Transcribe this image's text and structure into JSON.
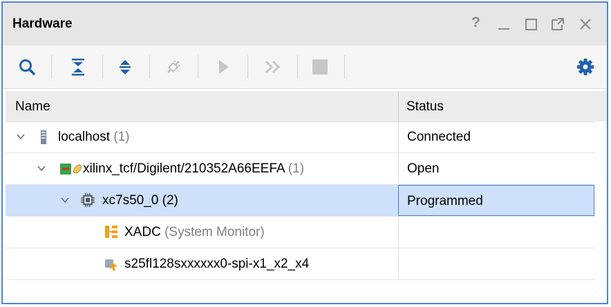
{
  "window": {
    "title": "Hardware",
    "controls": {
      "help": "?",
      "minimize_icon": "minimize-icon",
      "maximize_icon": "maximize-icon",
      "float_icon": "float-icon",
      "close_icon": "close-icon"
    }
  },
  "toolbar": {
    "buttons": [
      {
        "name": "search-button",
        "icon": "search-icon",
        "enabled": true
      },
      {
        "name": "collapse-all-button",
        "icon": "collapse-all-icon",
        "enabled": true
      },
      {
        "name": "expand-all-button",
        "icon": "expand-all-icon",
        "enabled": true
      },
      {
        "name": "auto-connect-button",
        "icon": "plug-icon",
        "enabled": false
      },
      {
        "name": "run-trigger-button",
        "icon": "play-icon",
        "enabled": false
      },
      {
        "name": "run-trigger-immediate-button",
        "icon": "fast-forward-icon",
        "enabled": false
      },
      {
        "name": "stop-trigger-button",
        "icon": "stop-icon",
        "enabled": false
      },
      {
        "name": "settings-button",
        "icon": "gear-icon",
        "enabled": true
      }
    ],
    "accent": "#1f5fae"
  },
  "table": {
    "columns": [
      "Name",
      "Status"
    ],
    "rows": [
      {
        "label": "localhost",
        "count": "(1)",
        "status": "Connected",
        "icon": "server-icon",
        "expanded": true
      },
      {
        "label": "xilinx_tcf/Digilent/210352A66EEFA",
        "count": "(1)",
        "status": "Open",
        "icon": "jtag-cable-icon",
        "expanded": true
      },
      {
        "label": "xc7s50_0",
        "count": "(2)",
        "status": "Programmed",
        "icon": "fpga-chip-icon",
        "expanded": true,
        "selected": true
      },
      {
        "label": "XADC",
        "count": "(System Monitor)",
        "status": "",
        "icon": "xadc-icon"
      },
      {
        "label": "s25fl128sxxxxxx0-spi-x1_x2_x4",
        "count": "",
        "status": "",
        "icon": "flash-memory-icon"
      }
    ]
  },
  "colors": {
    "border": "#4f84d6",
    "selection": "#cfe0fb",
    "count_text": "#808080"
  }
}
